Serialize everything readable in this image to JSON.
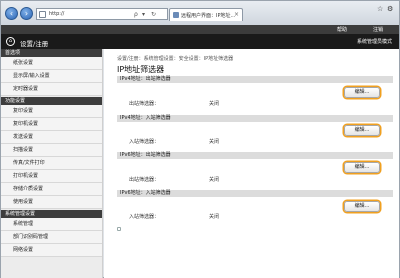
{
  "browser": {
    "url": "http://",
    "tab_title": "远程用户界面：IP地址...",
    "tab_close": "×",
    "address_controls": [
      "▾",
      "↻"
    ],
    "search_glyph": "ρ",
    "window_controls": [
      "☆",
      "⚙"
    ]
  },
  "app": {
    "top_links": [
      "帮助",
      "注销"
    ],
    "title": "设置/注册",
    "mode_label": "系统管理员模式"
  },
  "sidebar": {
    "groups": [
      {
        "header": "首选项",
        "items": [
          "纸张设置",
          "显示屏/输入设置",
          "定时器设置"
        ]
      },
      {
        "header": "功能设置",
        "items": [
          "复印设置",
          "复印机设置",
          "发送设置",
          "扫描设置",
          "传真/文件打印",
          "打印机设置",
          "存储介质设置",
          "使用设置"
        ]
      },
      {
        "header": "系统管理设置",
        "items": [
          "系统管理",
          "部门识别码管理"
        ]
      }
    ],
    "last_item": "网络设置"
  },
  "main": {
    "breadcrumb": "设置/注册：系统管理设置：安全设置：IP地址筛选器",
    "title": "IP地址筛选器",
    "sections": [
      {
        "header": "IPv4地址：出站筛选器",
        "label": "出站筛选器：",
        "value": "关闭",
        "button": "编辑..."
      },
      {
        "header": "IPv4地址：入站筛选器",
        "label": "入站筛选器：",
        "value": "关闭",
        "button": "编辑..."
      },
      {
        "header": "IPv6地址：出站筛选器",
        "label": "出站筛选器：",
        "value": "关闭",
        "button": "编辑..."
      },
      {
        "header": "IPv6地址：入站筛选器",
        "label": "入站筛选器：",
        "value": "关闭",
        "button": "编辑..."
      }
    ]
  },
  "colors": {
    "header_bg": "#1a1a1a",
    "sidebar_head_bg": "#3d3d3d",
    "button_highlight": "#f0a020"
  }
}
